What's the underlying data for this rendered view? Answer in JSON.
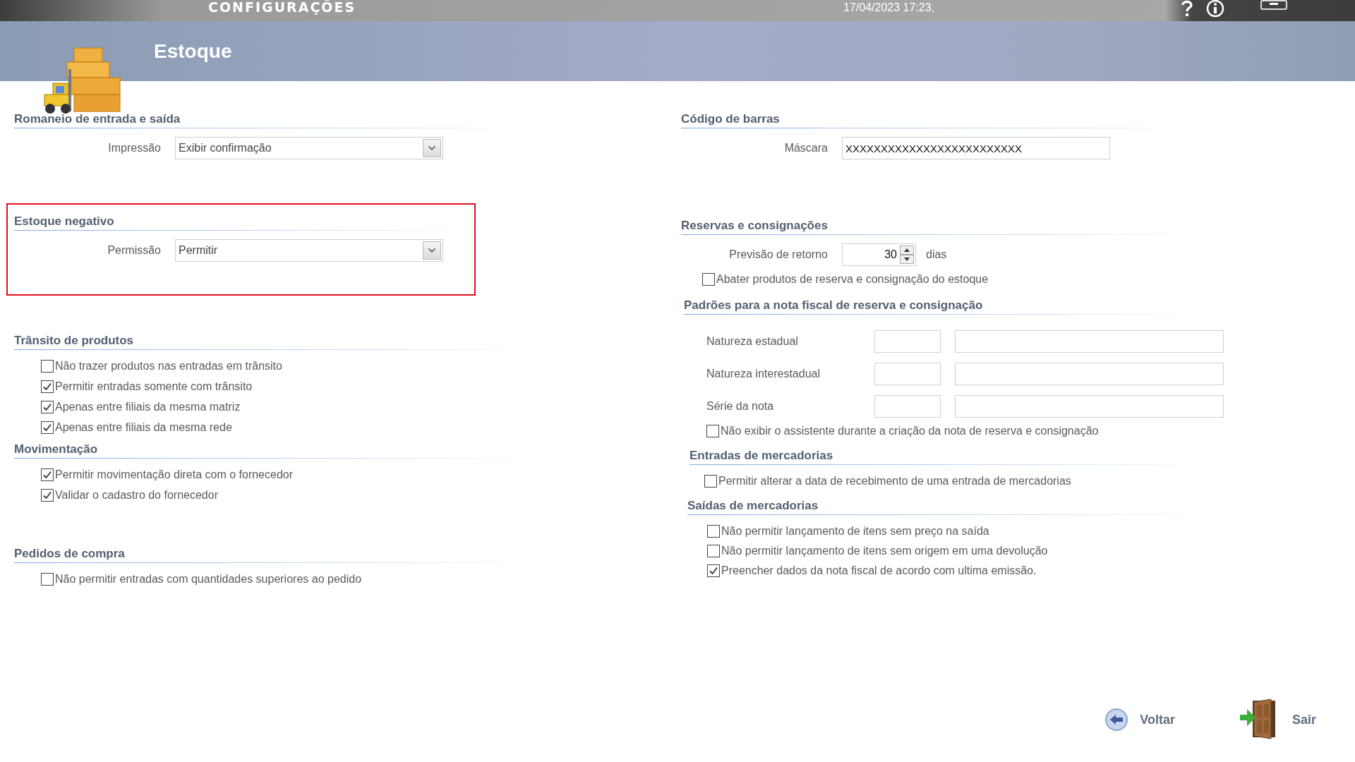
{
  "title_bar": {
    "title": "CONFIGURAÇÕES",
    "datetime": "17/04/2023 17:23,"
  },
  "header": {
    "title": "Estoque"
  },
  "left_sections": [
    {
      "heading": "Romaneio de entrada e saída",
      "highlighted": false,
      "rows": [
        {
          "kind": "select",
          "label": "Impressão",
          "value": "Exibir confirmação"
        }
      ]
    },
    {
      "heading": "Estoque negativo",
      "highlighted": true,
      "rows": [
        {
          "kind": "select",
          "label": "Permissão",
          "value": "Permitir"
        }
      ]
    },
    {
      "heading": "Trânsito de produtos",
      "highlighted": false,
      "rows": [
        {
          "kind": "checkbox",
          "label": "Não trazer produtos nas entradas em trânsito",
          "checked": false
        },
        {
          "kind": "checkbox",
          "label": "Permitir entradas somente com trânsito",
          "checked": true
        },
        {
          "kind": "checkbox",
          "label": "Apenas entre filiais da mesma matriz",
          "checked": true
        },
        {
          "kind": "checkbox",
          "label": "Apenas entre filiais da mesma rede",
          "checked": true
        }
      ]
    },
    {
      "heading": "Movimentação",
      "highlighted": false,
      "rows": [
        {
          "kind": "checkbox",
          "label": "Permitir movimentação direta com o fornecedor",
          "checked": true
        },
        {
          "kind": "checkbox",
          "label": "Validar o cadastro do fornecedor",
          "checked": true
        }
      ]
    },
    {
      "heading": "Pedidos de compra",
      "highlighted": false,
      "rows": [
        {
          "kind": "checkbox",
          "label": "Não permitir entradas com quantidades superiores ao pedido",
          "checked": false
        }
      ]
    }
  ],
  "right_sections": [
    {
      "heading": "Código de barras",
      "highlighted": false,
      "rows": [
        {
          "kind": "text",
          "label": "Máscara",
          "value": "XXXXXXXXXXXXXXXXXXXXXXXXX"
        }
      ]
    },
    {
      "heading": "Reservas e consignações",
      "highlighted": false,
      "rows": [
        {
          "kind": "spinner",
          "label": "Previsão de retorno",
          "value": "30",
          "unit": "dias"
        },
        {
          "kind": "checkbox",
          "label": "Abater produtos de reserva e consignação do estoque",
          "checked": false
        }
      ]
    },
    {
      "heading": "Padrões para a nota fiscal de reserva e consignação",
      "highlighted": false,
      "rows": [
        {
          "kind": "pair",
          "label": "Natureza estadual"
        },
        {
          "kind": "pair",
          "label": "Natureza interestadual"
        },
        {
          "kind": "pair",
          "label": "Série da nota"
        },
        {
          "kind": "checkbox",
          "label": "Não exibir o assistente durante a criação da nota de reserva e consignação",
          "checked": false
        }
      ]
    },
    {
      "heading": "Entradas de mercadorias",
      "highlighted": false,
      "rows": [
        {
          "kind": "checkbox",
          "label": "Permitir alterar a data de recebimento de uma entrada de mercadorias",
          "checked": false
        }
      ]
    },
    {
      "heading": "Saídas de mercadorias",
      "highlighted": false,
      "rows": [
        {
          "kind": "checkbox",
          "label": "Não permitir lançamento de itens sem preço na saída",
          "checked": false
        },
        {
          "kind": "checkbox",
          "label": "Não permitir lançamento de itens sem origem em uma devolução",
          "checked": false
        },
        {
          "kind": "checkbox",
          "label": "Preencher dados da nota fiscal de acordo com ultima emissão.",
          "checked": true
        }
      ]
    }
  ],
  "buttons": [
    {
      "kind": "back",
      "label": "Voltar"
    },
    {
      "kind": "exit",
      "label": "Sair"
    }
  ]
}
